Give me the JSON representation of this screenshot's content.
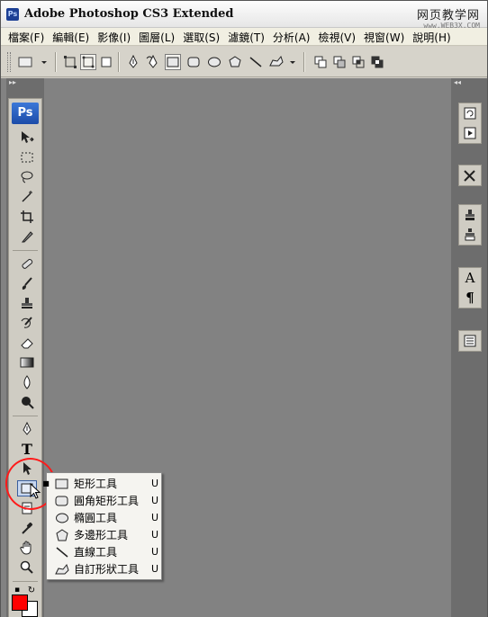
{
  "title": {
    "app_title": "Adobe Photoshop CS3 Extended",
    "badge": "Ps"
  },
  "watermark": {
    "line1": "网页教学网",
    "line2": "www.WEB3X.COM"
  },
  "menu": [
    "檔案(F)",
    "編輯(E)",
    "影像(I)",
    "圖層(L)",
    "選取(S)",
    "濾鏡(T)",
    "分析(A)",
    "檢視(V)",
    "視窗(W)",
    "說明(H)"
  ],
  "toolbox": {
    "logo": "Ps"
  },
  "flyout": {
    "items": [
      {
        "label": "矩形工具",
        "key": "U",
        "icon": "rectangle-icon",
        "selected": true
      },
      {
        "label": "圓角矩形工具",
        "key": "U",
        "icon": "rounded-rectangle-icon",
        "selected": false
      },
      {
        "label": "橢圓工具",
        "key": "U",
        "icon": "ellipse-icon",
        "selected": false
      },
      {
        "label": "多邊形工具",
        "key": "U",
        "icon": "polygon-icon",
        "selected": false
      },
      {
        "label": "直線工具",
        "key": "U",
        "icon": "line-icon",
        "selected": false
      },
      {
        "label": "自訂形狀工具",
        "key": "U",
        "icon": "custom-shape-icon",
        "selected": false
      }
    ],
    "selected_marker": "■"
  },
  "colors": {
    "foreground": "#ff0000",
    "background": "#ffffff",
    "workspace": "#828282",
    "annotation": "#ff1a1a"
  }
}
